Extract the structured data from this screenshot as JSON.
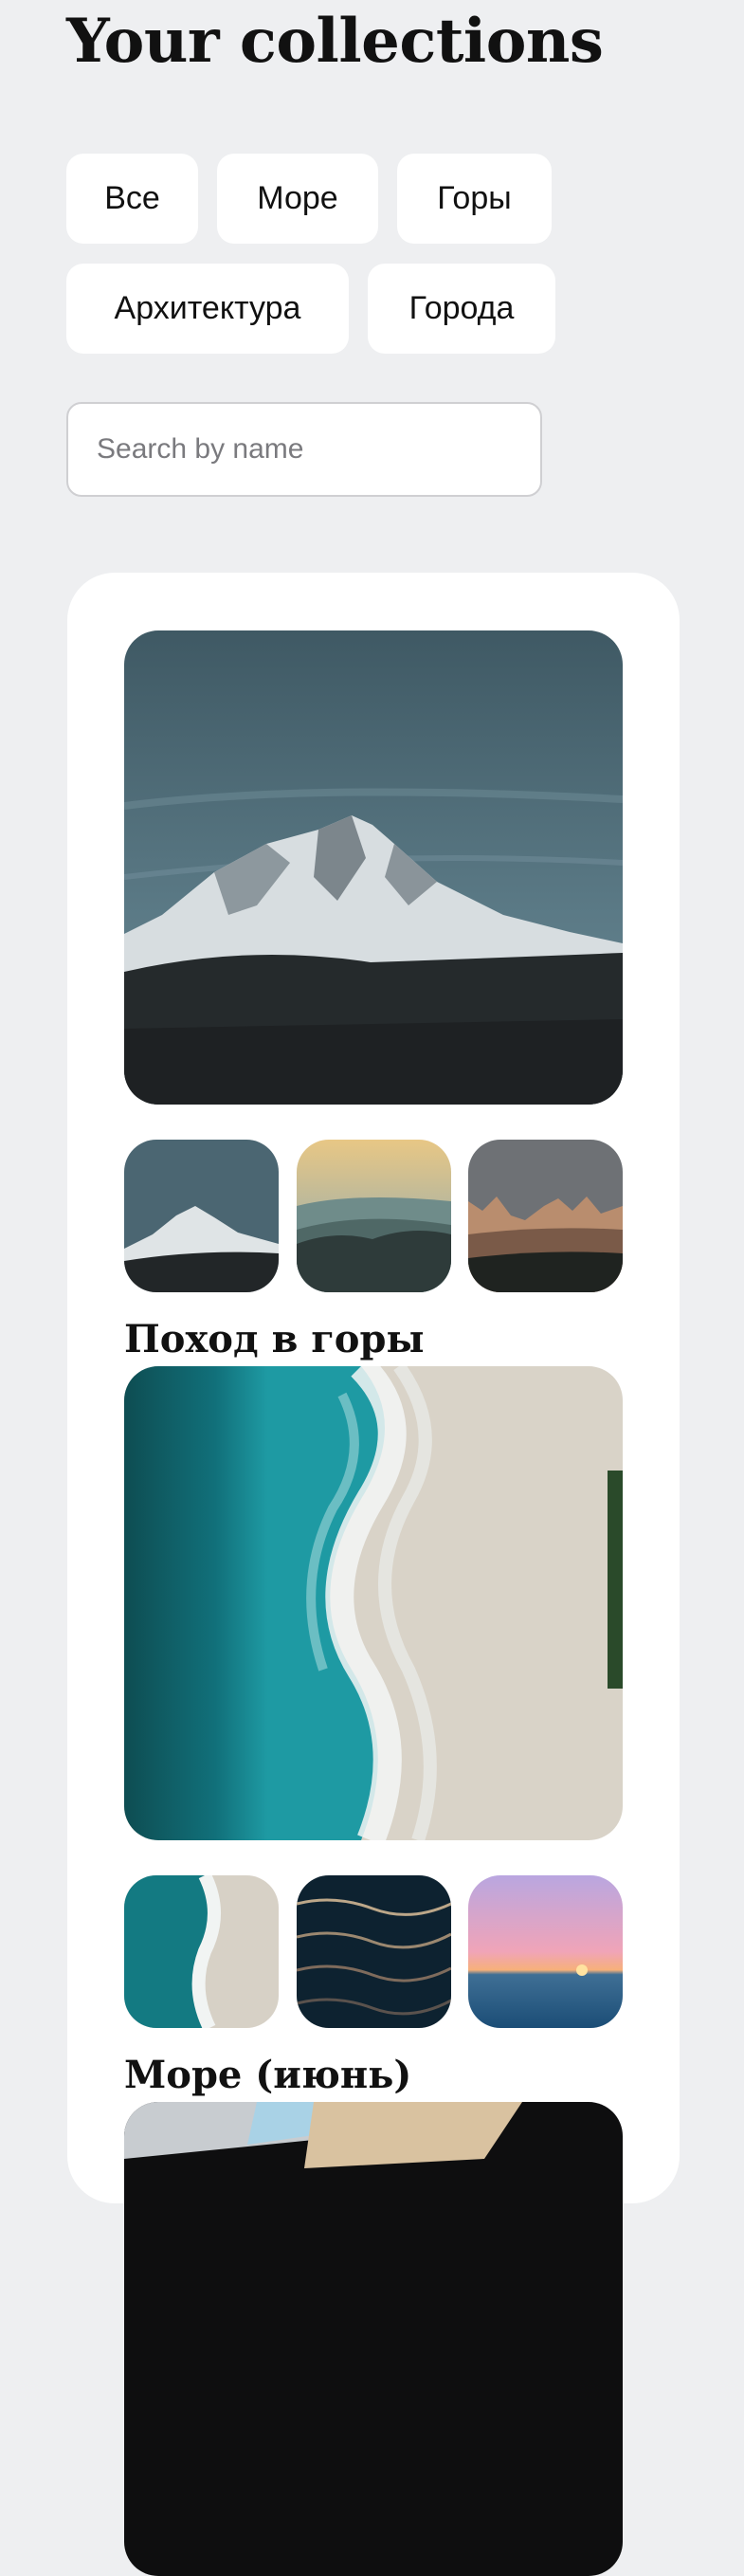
{
  "header": {
    "title": "Your collections"
  },
  "filters": {
    "row1": [
      "Все",
      "Море",
      "Горы"
    ],
    "row2": [
      "Архитектура",
      "Города"
    ]
  },
  "search": {
    "placeholder": "Search by name",
    "value": ""
  },
  "collections": [
    {
      "title": "Поход в горы",
      "main_image": "snowy-mountain-peak",
      "thumbs": [
        "snowy-mountain-small",
        "misty-hills-sunset",
        "rocky-peaks-dusk"
      ]
    },
    {
      "title": "Море (июнь)",
      "main_image": "aerial-beach-waves",
      "thumbs": [
        "beach-waves-small",
        "dark-water-sparkles",
        "pink-sunset-sea"
      ]
    },
    {
      "title": "",
      "main_image": "architecture-interior",
      "thumbs": []
    }
  ]
}
